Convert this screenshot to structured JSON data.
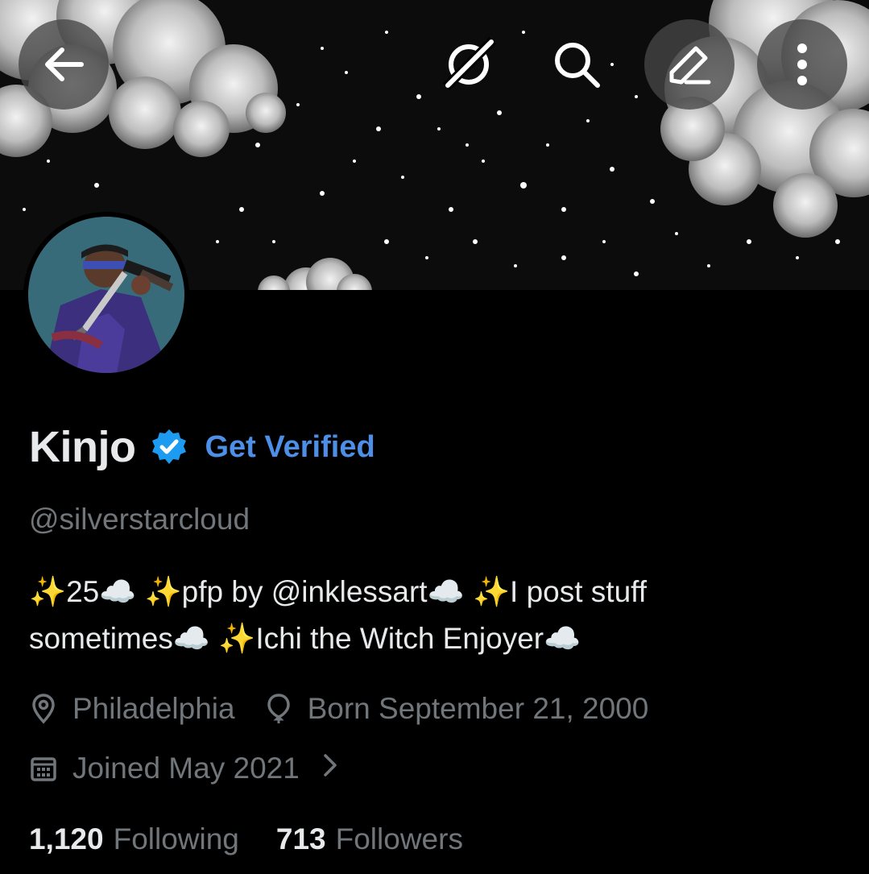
{
  "profile": {
    "name": "Kinjo",
    "get_verified_label": "Get Verified",
    "handle": "@silverstarcloud",
    "bio": {
      "line1": [
        {
          "t": "spark",
          "v": "✨"
        },
        {
          "t": "text",
          "v": "25"
        },
        {
          "t": "cloud",
          "v": "☁️"
        },
        {
          "t": "text",
          "v": " "
        },
        {
          "t": "spark",
          "v": "✨"
        },
        {
          "t": "text",
          "v": "pfp by @inklessart"
        },
        {
          "t": "cloud",
          "v": "☁️"
        },
        {
          "t": "text",
          "v": " "
        },
        {
          "t": "spark",
          "v": "✨"
        },
        {
          "t": "text",
          "v": "I post stuff"
        }
      ],
      "line2": [
        {
          "t": "text",
          "v": "sometimes"
        },
        {
          "t": "cloud",
          "v": "☁️"
        },
        {
          "t": "text",
          "v": " "
        },
        {
          "t": "spark",
          "v": "✨"
        },
        {
          "t": "text",
          "v": "Ichi the Witch Enjoyer"
        },
        {
          "t": "cloud",
          "v": "☁️"
        }
      ]
    },
    "location": "Philadelphia",
    "birthday": "Born September 21, 2000",
    "joined": "Joined May 2021",
    "following_count": "1,120",
    "following_label": "Following",
    "followers_count": "713",
    "followers_label": "Followers"
  },
  "icons": {
    "back": "arrow-left-icon",
    "grok": "grok-icon",
    "search": "search-icon",
    "edit": "edit-icon",
    "more": "more-vertical-icon",
    "verified": "verified-badge-icon",
    "location": "location-pin-icon",
    "birthday": "balloon-icon",
    "joined": "calendar-icon",
    "joined_chevron": "chevron-right-icon"
  },
  "colors": {
    "background": "#000000",
    "primary_text": "#e7e9ea",
    "secondary_text": "#71767b",
    "accent_blue": "#4d8ee6",
    "verified_badge": "#1d9bf0"
  }
}
